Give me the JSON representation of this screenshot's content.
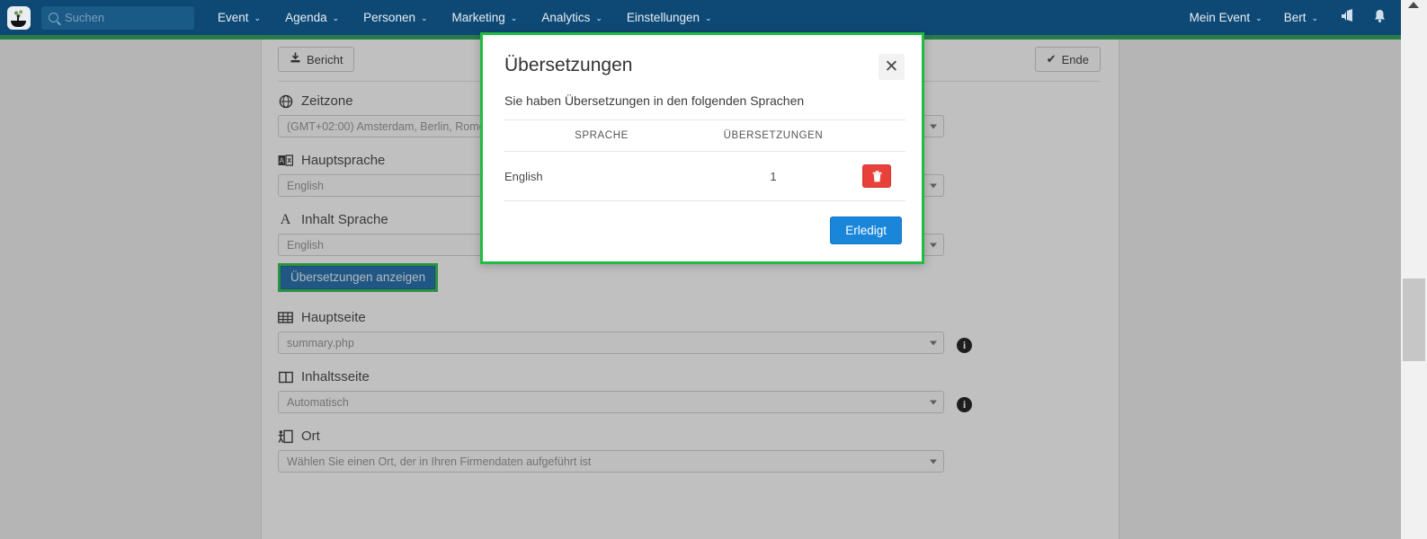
{
  "navbar": {
    "logo_name": "app-logo",
    "search": {
      "placeholder": "Suchen"
    },
    "menu": [
      {
        "label": "Event"
      },
      {
        "label": "Agenda"
      },
      {
        "label": "Personen"
      },
      {
        "label": "Marketing"
      },
      {
        "label": "Analytics"
      },
      {
        "label": "Einstellungen"
      }
    ],
    "right": [
      {
        "label": "Mein Event"
      },
      {
        "label": "Bert"
      }
    ],
    "icons": [
      {
        "name": "megaphone-icon",
        "glyph": "📢"
      },
      {
        "name": "bell-icon",
        "glyph": "🔔"
      }
    ],
    "caret": "⌄",
    "accent_color": "#1f9a4d",
    "bg_color": "#0e4975"
  },
  "toolbar": {
    "report_label": "Bericht",
    "report_icon": "⤓",
    "end_label": "Ende",
    "end_icon": "✔"
  },
  "form": {
    "fields": [
      {
        "label": "Zeitzone",
        "icon": "globe-icon",
        "value": "(GMT+02:00) Amsterdam, Berlin, Rome",
        "has_info": false
      },
      {
        "label": "Hauptsprache",
        "icon": "translate-icon",
        "value": "English",
        "has_info": false
      },
      {
        "label": "Inhalt Sprache",
        "icon": "letter-a-icon",
        "value": "English",
        "has_info": false
      },
      {
        "label": "Hauptseite",
        "icon": "grid-icon",
        "value": "summary.php",
        "has_info": true
      },
      {
        "label": "Inhaltsseite",
        "icon": "columns-icon",
        "value": "Automatisch",
        "has_info": true
      },
      {
        "label": "Ort",
        "icon": "venue-icon",
        "value": "Wählen Sie einen Ort, der in Ihren Firmendaten aufgeführt ist",
        "has_info": false
      }
    ],
    "show_translations_label": "Übersetzungen anzeigen",
    "highlight_color": "#22bb44"
  },
  "modal": {
    "title": "Übersetzungen",
    "close_icon": "✕",
    "subtitle": "Sie haben Übersetzungen in den folgenden Sprachen",
    "table": {
      "headers": [
        "SPRACHE",
        "ÜBERSETZUNGEN",
        ""
      ],
      "rows": [
        {
          "language": "English",
          "translations": "1",
          "delete_icon": "🗑"
        }
      ]
    },
    "confirm_label": "Erledigt",
    "border_color": "#22bb44",
    "confirm_color": "#1a86d9",
    "delete_color": "#e8413a"
  },
  "scrollbar": {
    "up_arrow": "▲"
  }
}
